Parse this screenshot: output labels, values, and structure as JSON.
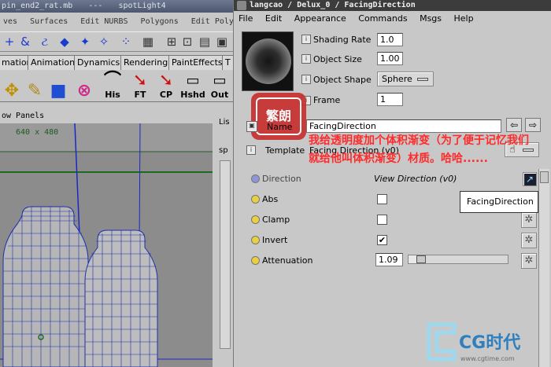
{
  "maya": {
    "title_parts": [
      "pin_end2_rat.mb",
      "---",
      "spotLight4"
    ],
    "menus": [
      "ves",
      "Surfaces",
      "Edit NURBS",
      "Polygons",
      "Edit Polygon"
    ],
    "shelf_tabs": [
      "mation",
      "Animation",
      "Dynamics",
      "Rendering",
      "PaintEffects",
      "T"
    ],
    "shelf_buttons": [
      {
        "label": "His",
        "icon": "history-icon"
      },
      {
        "label": "FT",
        "icon": "freeze-transform-icon"
      },
      {
        "label": "CP",
        "icon": "center-pivot-icon"
      },
      {
        "label": "Hshd",
        "icon": "hypershade-icon"
      },
      {
        "label": "Out",
        "icon": "outliner-icon"
      }
    ],
    "panel_bar": "ow  Panels",
    "viewport_resolution": "640 x 480",
    "side_strip": [
      "Lis",
      "sp"
    ]
  },
  "attribute_editor": {
    "title": "langcao / Delux_0 / FacingDirection",
    "menus": [
      "File",
      "Edit",
      "Appearance",
      "Commands",
      "Msgs",
      "Help"
    ],
    "shading_rate_label": "Shading Rate",
    "shading_rate": "1.0",
    "object_size_label": "Object Size",
    "object_size": "1.00",
    "object_shape_label": "Object Shape",
    "object_shape": "Sphere",
    "frame_label": "Frame",
    "frame": "1",
    "name_label": "Name",
    "name_value": "FacingDirection",
    "template_label": "Template",
    "template_value": "Facing Direction (v0)",
    "stamp_text": "繁朗",
    "annotation": "我给透明度加个体积渐变（为了便于记忆我们就给他叫体积渐变）材质。哈哈......",
    "tooltip": "FacingDirection",
    "params": [
      {
        "label": "Direction",
        "value": "View Direction (v0)",
        "type": "text"
      },
      {
        "label": "Abs",
        "checked": false,
        "type": "checkbox"
      },
      {
        "label": "Clamp",
        "checked": false,
        "type": "checkbox"
      },
      {
        "label": "Invert",
        "checked": true,
        "type": "checkbox"
      },
      {
        "label": "Attenuation",
        "value": "1.09",
        "type": "slider",
        "level": 0.09
      }
    ],
    "colors": {
      "annotation": "#ff2a2a",
      "stamp": "#c83030",
      "titlebar": "#3c3c3c"
    }
  },
  "watermark": {
    "brand": "CG时代",
    "url": "www.cgtime.com"
  }
}
